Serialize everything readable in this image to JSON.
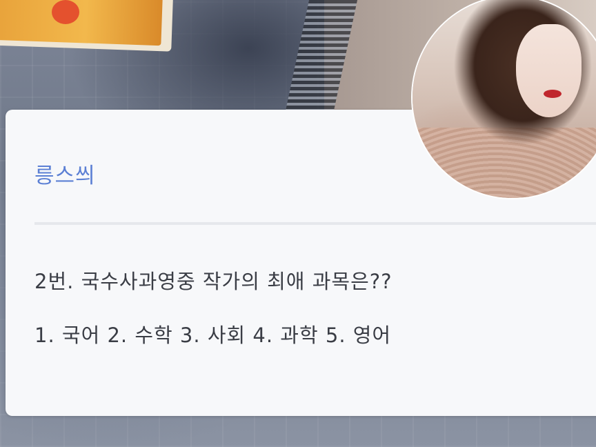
{
  "card": {
    "title": "릉스씌",
    "question": "2번. 국수사과영중 작가의 최애 과목은??",
    "options": "1. 국어 2. 수학 3. 사회 4. 과학 5. 영어"
  },
  "colors": {
    "title": "#5b7fd4",
    "text": "#3a3d45",
    "card_background": "#f7f8fa",
    "divider": "#e6e8ec"
  },
  "avatar": {
    "icon": "profile-photo"
  }
}
